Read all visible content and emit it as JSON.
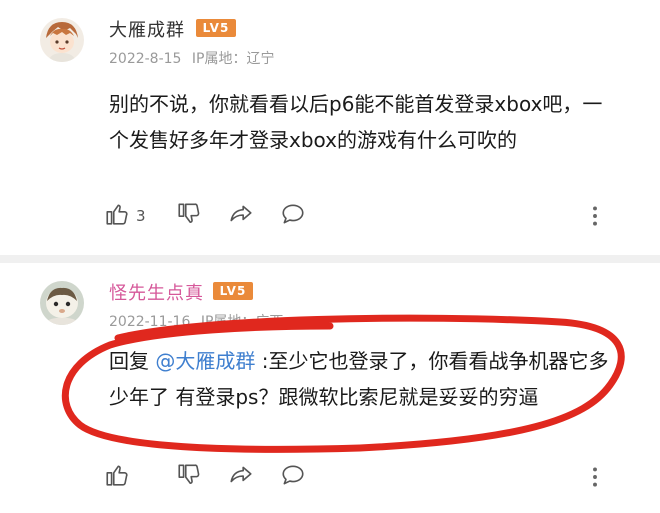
{
  "comments": [
    {
      "user": "大雁成群",
      "level": "LV5",
      "date": "2022-8-15",
      "location_label": "IP属地：辽宁",
      "text": "别的不说，你就看看以后p6能不能首发登录xbox吧，一个发售好多年才登录xbox的游戏有什么可吹的",
      "likes": "3"
    },
    {
      "user": "怪先生点真",
      "level": "LV5",
      "date": "2022-11-16",
      "location_label": "IP属地：广西",
      "reply_prefix": "回复 ",
      "mention": "@大雁成群",
      "text": " :至少它也登录了，你看看战争机器它多少年了  有登录ps？跟微软比索尼就是妥妥的穷逼"
    }
  ],
  "colors": {
    "accent_name": "#d6589a",
    "mention": "#3f7fcf",
    "badge": "#ea8a3a",
    "highlight_oval": "#e0281e"
  },
  "icons": [
    "thumbs-up-icon",
    "thumbs-down-icon",
    "share-icon",
    "comment-icon",
    "more-icon"
  ]
}
